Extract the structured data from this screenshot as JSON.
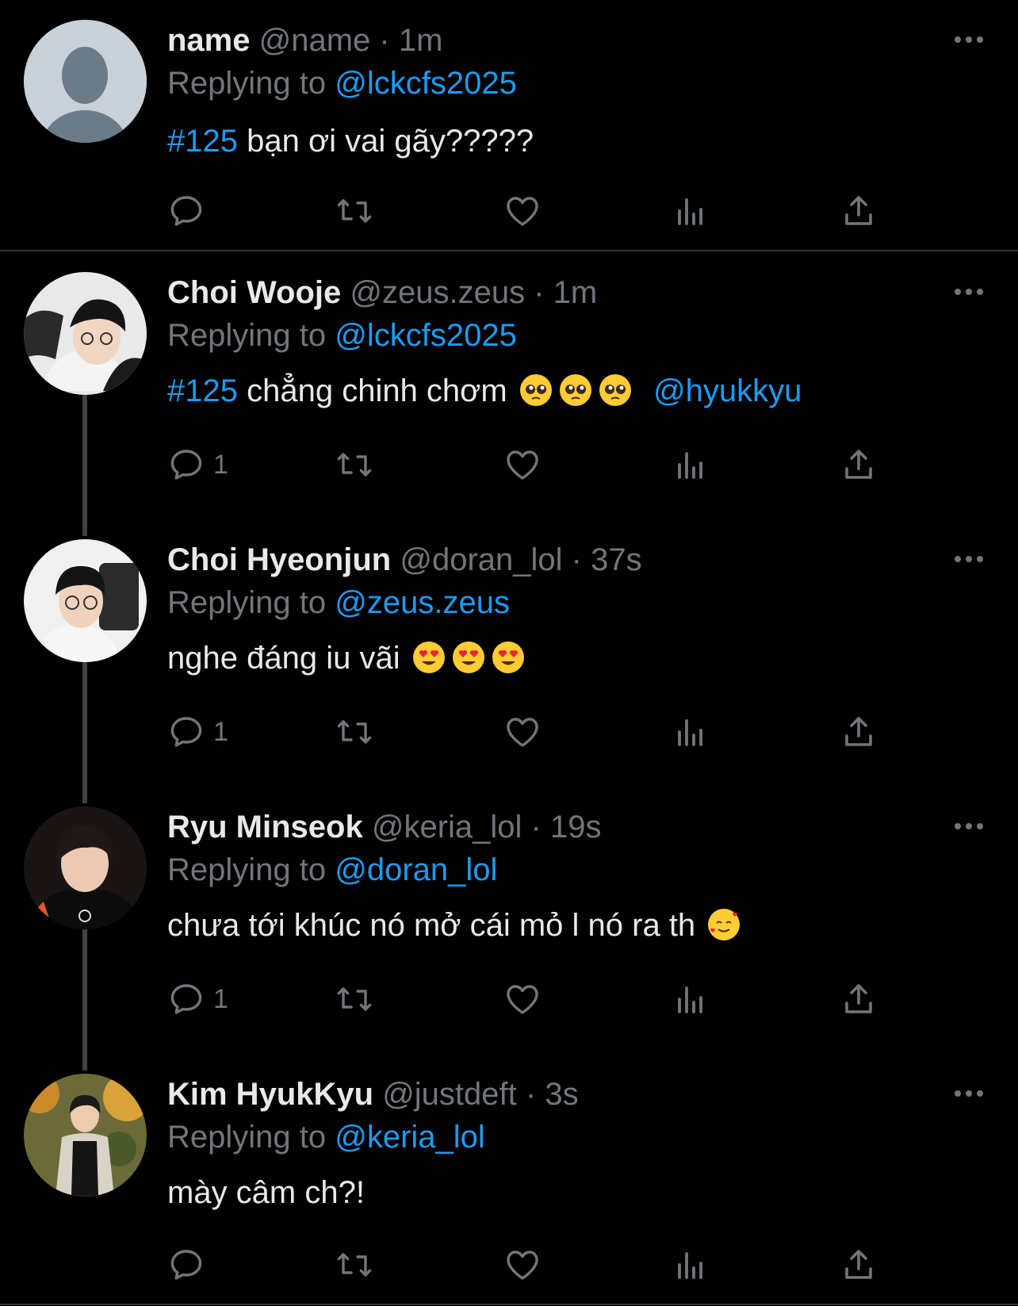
{
  "tweets": [
    {
      "name": "name",
      "handle": "@name",
      "time": "· 1m",
      "replying_prefix": "Replying to ",
      "replying_to": "@lckcfs2025",
      "hashtag": "#125",
      "text": " bạn ơi vai gãy?????",
      "reply_count": "",
      "avatar": "default-profile"
    },
    {
      "name": "Choi Wooje",
      "handle": "@zeus.zeus",
      "time": "· 1m",
      "replying_prefix": "Replying to ",
      "replying_to": "@lckcfs2025",
      "hashtag": "#125",
      "text": " chẳng chinh chơm",
      "trailing_mention": "@hyukkyu",
      "emoji": [
        "pleading-face",
        "pleading-face",
        "pleading-face"
      ],
      "reply_count": "1",
      "avatar": "photo"
    },
    {
      "name": "Choi Hyeonjun",
      "handle": "@doran_lol",
      "time": "· 37s",
      "replying_prefix": "Replying to ",
      "replying_to": "@zeus.zeus",
      "text": "nghe đáng iu vãi",
      "emoji": [
        "heart-eyes",
        "heart-eyes",
        "heart-eyes"
      ],
      "reply_count": "1",
      "avatar": "photo"
    },
    {
      "name": "Ryu Minseok",
      "handle": "@keria_lol",
      "time": "· 19s",
      "replying_prefix": "Replying to ",
      "replying_to": "@doran_lol",
      "text": "chưa tới khúc nó mở cái mỏ l nó ra th",
      "emoji": [
        "smiling-face-with-hearts"
      ],
      "reply_count": "1",
      "avatar": "photo"
    },
    {
      "name": "Kim HyukKyu",
      "handle": "@justdeft",
      "time": "· 3s",
      "replying_prefix": "Replying to ",
      "replying_to": "@keria_lol",
      "text": "mày câm ch?!",
      "reply_count": "",
      "avatar": "photo"
    }
  ],
  "icons": [
    "reply-icon",
    "retweet-icon",
    "like-icon",
    "views-icon",
    "share-icon",
    "more-icon"
  ],
  "colors": {
    "background": "#000000",
    "text": "#e7e9ea",
    "secondary": "#71767b",
    "accent": "#1d9bf0",
    "divider": "#2f3336"
  }
}
